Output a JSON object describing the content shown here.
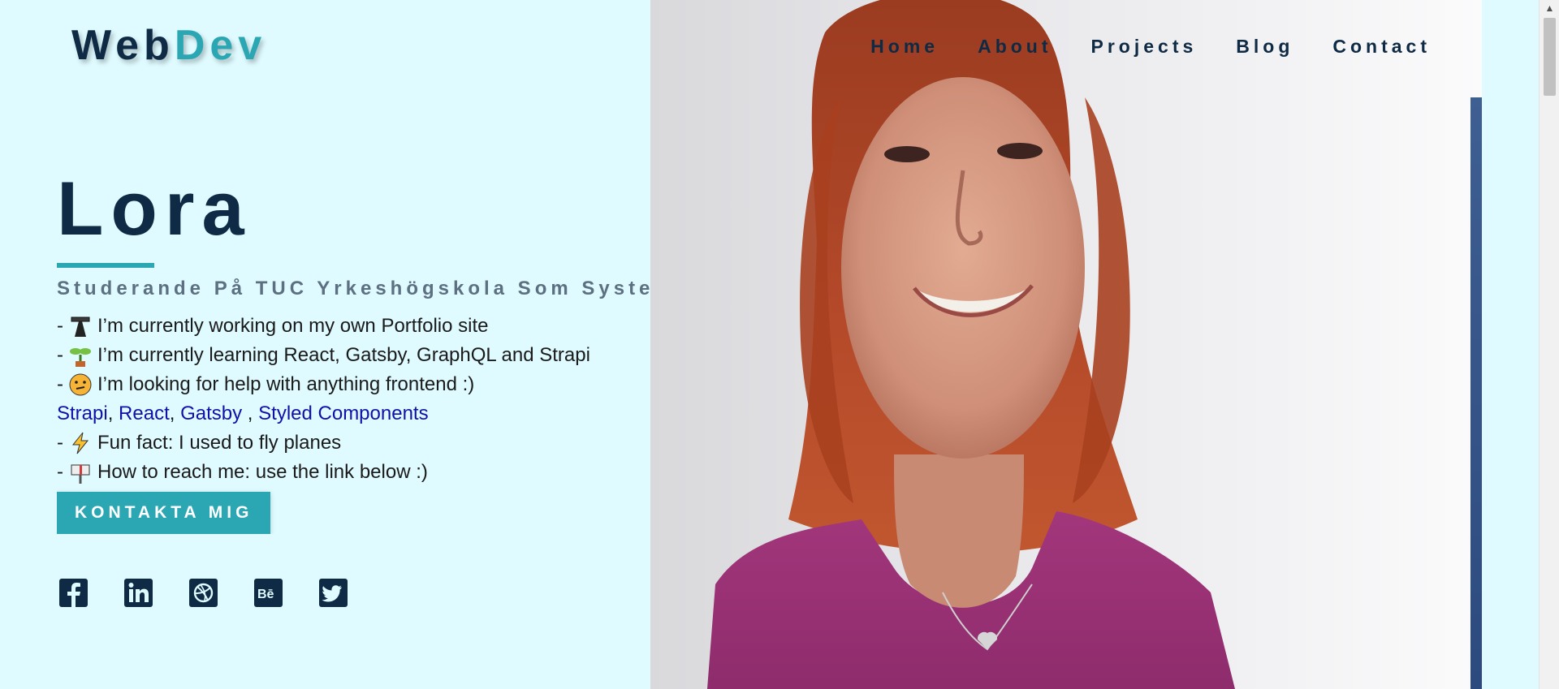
{
  "logo": {
    "part1": "Web",
    "part2": "Dev"
  },
  "nav": {
    "home": "Home",
    "about": "About",
    "projects": "Projects",
    "blog": "Blog",
    "contact": "Contact"
  },
  "intro": {
    "name": "Lora",
    "subtitle": "Studerande På TUC Yrkeshögskola Som Systemutvecklare",
    "lines": [
      "I’m currently working on my own Portfolio site",
      "I’m currently learning React, Gatsby, GraphQL and Strapi",
      "I’m looking for help with anything frontend :)"
    ],
    "tech_links": [
      "Strapi",
      "React",
      "Gatsby",
      "Styled Components"
    ],
    "fun_fact": "Fun fact: I used to fly planes",
    "reach": "How to reach me: use the link below :)",
    "line_prefix": "-"
  },
  "cta": {
    "label": "KONTAKTA MIG"
  },
  "social": [
    "facebook-icon",
    "linkedin-icon",
    "dribbble-icon",
    "behance-icon",
    "twitter-icon"
  ],
  "colors": {
    "accent": "#2aa7b3",
    "dark": "#0e2a44",
    "background": "#dffbff",
    "link": "#1111aa"
  }
}
